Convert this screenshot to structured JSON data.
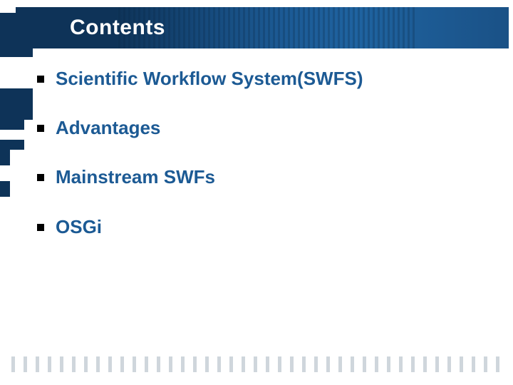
{
  "header": {
    "title": "Contents",
    "icon": "pointing-hand-icon"
  },
  "content": {
    "items": [
      {
        "label": "Scientific Workflow System(SWFS)"
      },
      {
        "label": "Advantages"
      },
      {
        "label": "Mainstream SWFs"
      },
      {
        "label": "OSGi"
      }
    ]
  },
  "colors": {
    "accent": "#1c5a94",
    "header_dark": "#0e3358",
    "tick": "#cfd6dc"
  }
}
